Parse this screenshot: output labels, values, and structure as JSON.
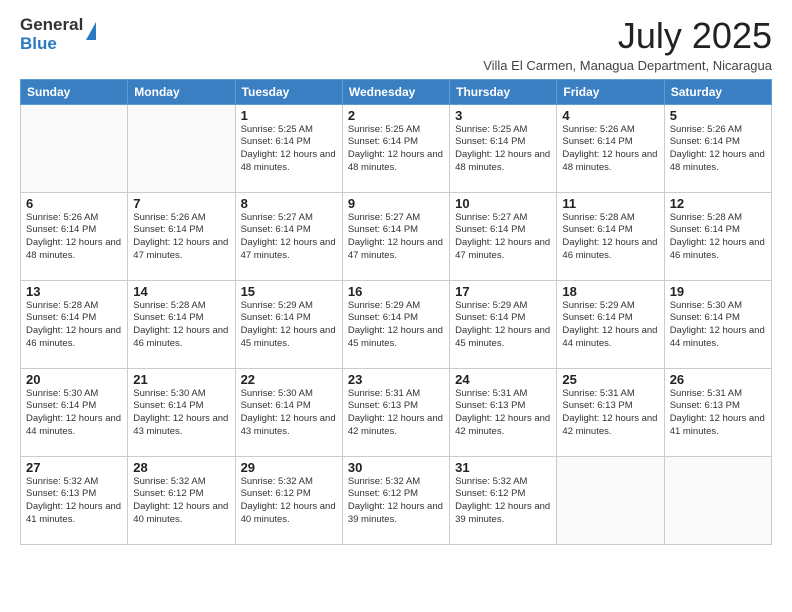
{
  "logo": {
    "general": "General",
    "blue": "Blue"
  },
  "title": "July 2025",
  "subtitle": "Villa El Carmen, Managua Department, Nicaragua",
  "days_of_week": [
    "Sunday",
    "Monday",
    "Tuesday",
    "Wednesday",
    "Thursday",
    "Friday",
    "Saturday"
  ],
  "weeks": [
    [
      {
        "day": "",
        "info": ""
      },
      {
        "day": "",
        "info": ""
      },
      {
        "day": "1",
        "info": "Sunrise: 5:25 AM\nSunset: 6:14 PM\nDaylight: 12 hours and 48 minutes."
      },
      {
        "day": "2",
        "info": "Sunrise: 5:25 AM\nSunset: 6:14 PM\nDaylight: 12 hours and 48 minutes."
      },
      {
        "day": "3",
        "info": "Sunrise: 5:25 AM\nSunset: 6:14 PM\nDaylight: 12 hours and 48 minutes."
      },
      {
        "day": "4",
        "info": "Sunrise: 5:26 AM\nSunset: 6:14 PM\nDaylight: 12 hours and 48 minutes."
      },
      {
        "day": "5",
        "info": "Sunrise: 5:26 AM\nSunset: 6:14 PM\nDaylight: 12 hours and 48 minutes."
      }
    ],
    [
      {
        "day": "6",
        "info": "Sunrise: 5:26 AM\nSunset: 6:14 PM\nDaylight: 12 hours and 48 minutes."
      },
      {
        "day": "7",
        "info": "Sunrise: 5:26 AM\nSunset: 6:14 PM\nDaylight: 12 hours and 47 minutes."
      },
      {
        "day": "8",
        "info": "Sunrise: 5:27 AM\nSunset: 6:14 PM\nDaylight: 12 hours and 47 minutes."
      },
      {
        "day": "9",
        "info": "Sunrise: 5:27 AM\nSunset: 6:14 PM\nDaylight: 12 hours and 47 minutes."
      },
      {
        "day": "10",
        "info": "Sunrise: 5:27 AM\nSunset: 6:14 PM\nDaylight: 12 hours and 47 minutes."
      },
      {
        "day": "11",
        "info": "Sunrise: 5:28 AM\nSunset: 6:14 PM\nDaylight: 12 hours and 46 minutes."
      },
      {
        "day": "12",
        "info": "Sunrise: 5:28 AM\nSunset: 6:14 PM\nDaylight: 12 hours and 46 minutes."
      }
    ],
    [
      {
        "day": "13",
        "info": "Sunrise: 5:28 AM\nSunset: 6:14 PM\nDaylight: 12 hours and 46 minutes."
      },
      {
        "day": "14",
        "info": "Sunrise: 5:28 AM\nSunset: 6:14 PM\nDaylight: 12 hours and 46 minutes."
      },
      {
        "day": "15",
        "info": "Sunrise: 5:29 AM\nSunset: 6:14 PM\nDaylight: 12 hours and 45 minutes."
      },
      {
        "day": "16",
        "info": "Sunrise: 5:29 AM\nSunset: 6:14 PM\nDaylight: 12 hours and 45 minutes."
      },
      {
        "day": "17",
        "info": "Sunrise: 5:29 AM\nSunset: 6:14 PM\nDaylight: 12 hours and 45 minutes."
      },
      {
        "day": "18",
        "info": "Sunrise: 5:29 AM\nSunset: 6:14 PM\nDaylight: 12 hours and 44 minutes."
      },
      {
        "day": "19",
        "info": "Sunrise: 5:30 AM\nSunset: 6:14 PM\nDaylight: 12 hours and 44 minutes."
      }
    ],
    [
      {
        "day": "20",
        "info": "Sunrise: 5:30 AM\nSunset: 6:14 PM\nDaylight: 12 hours and 44 minutes."
      },
      {
        "day": "21",
        "info": "Sunrise: 5:30 AM\nSunset: 6:14 PM\nDaylight: 12 hours and 43 minutes."
      },
      {
        "day": "22",
        "info": "Sunrise: 5:30 AM\nSunset: 6:14 PM\nDaylight: 12 hours and 43 minutes."
      },
      {
        "day": "23",
        "info": "Sunrise: 5:31 AM\nSunset: 6:13 PM\nDaylight: 12 hours and 42 minutes."
      },
      {
        "day": "24",
        "info": "Sunrise: 5:31 AM\nSunset: 6:13 PM\nDaylight: 12 hours and 42 minutes."
      },
      {
        "day": "25",
        "info": "Sunrise: 5:31 AM\nSunset: 6:13 PM\nDaylight: 12 hours and 42 minutes."
      },
      {
        "day": "26",
        "info": "Sunrise: 5:31 AM\nSunset: 6:13 PM\nDaylight: 12 hours and 41 minutes."
      }
    ],
    [
      {
        "day": "27",
        "info": "Sunrise: 5:32 AM\nSunset: 6:13 PM\nDaylight: 12 hours and 41 minutes."
      },
      {
        "day": "28",
        "info": "Sunrise: 5:32 AM\nSunset: 6:12 PM\nDaylight: 12 hours and 40 minutes."
      },
      {
        "day": "29",
        "info": "Sunrise: 5:32 AM\nSunset: 6:12 PM\nDaylight: 12 hours and 40 minutes."
      },
      {
        "day": "30",
        "info": "Sunrise: 5:32 AM\nSunset: 6:12 PM\nDaylight: 12 hours and 39 minutes."
      },
      {
        "day": "31",
        "info": "Sunrise: 5:32 AM\nSunset: 6:12 PM\nDaylight: 12 hours and 39 minutes."
      },
      {
        "day": "",
        "info": ""
      },
      {
        "day": "",
        "info": ""
      }
    ]
  ]
}
